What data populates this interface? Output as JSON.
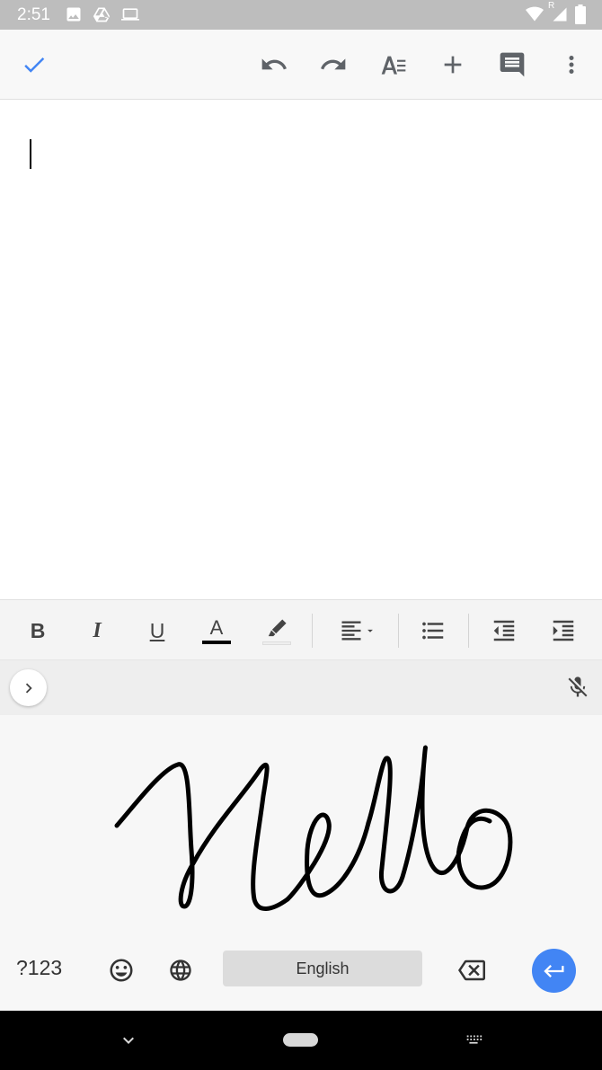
{
  "status_bar": {
    "time": "2:51",
    "left_icons": [
      "image-icon",
      "drive-icon",
      "laptop-icon"
    ],
    "right_icons": [
      "wifi-icon",
      "signal-icon",
      "battery-icon"
    ],
    "signal_roaming": "R"
  },
  "toolbar": {
    "icons": [
      "check-icon",
      "undo-icon",
      "redo-icon",
      "text-format-icon",
      "add-icon",
      "comment-icon",
      "more-vert-icon"
    ],
    "accent": "#4285f4"
  },
  "format_bar": {
    "bold": "B",
    "italic": "I",
    "underline": "U",
    "text_color": "A",
    "text_color_value": "#000000"
  },
  "keyboard": {
    "symbols_label": "?123",
    "space_label": "English",
    "enter_color": "#4285f4",
    "handwriting_text": "Hello"
  }
}
